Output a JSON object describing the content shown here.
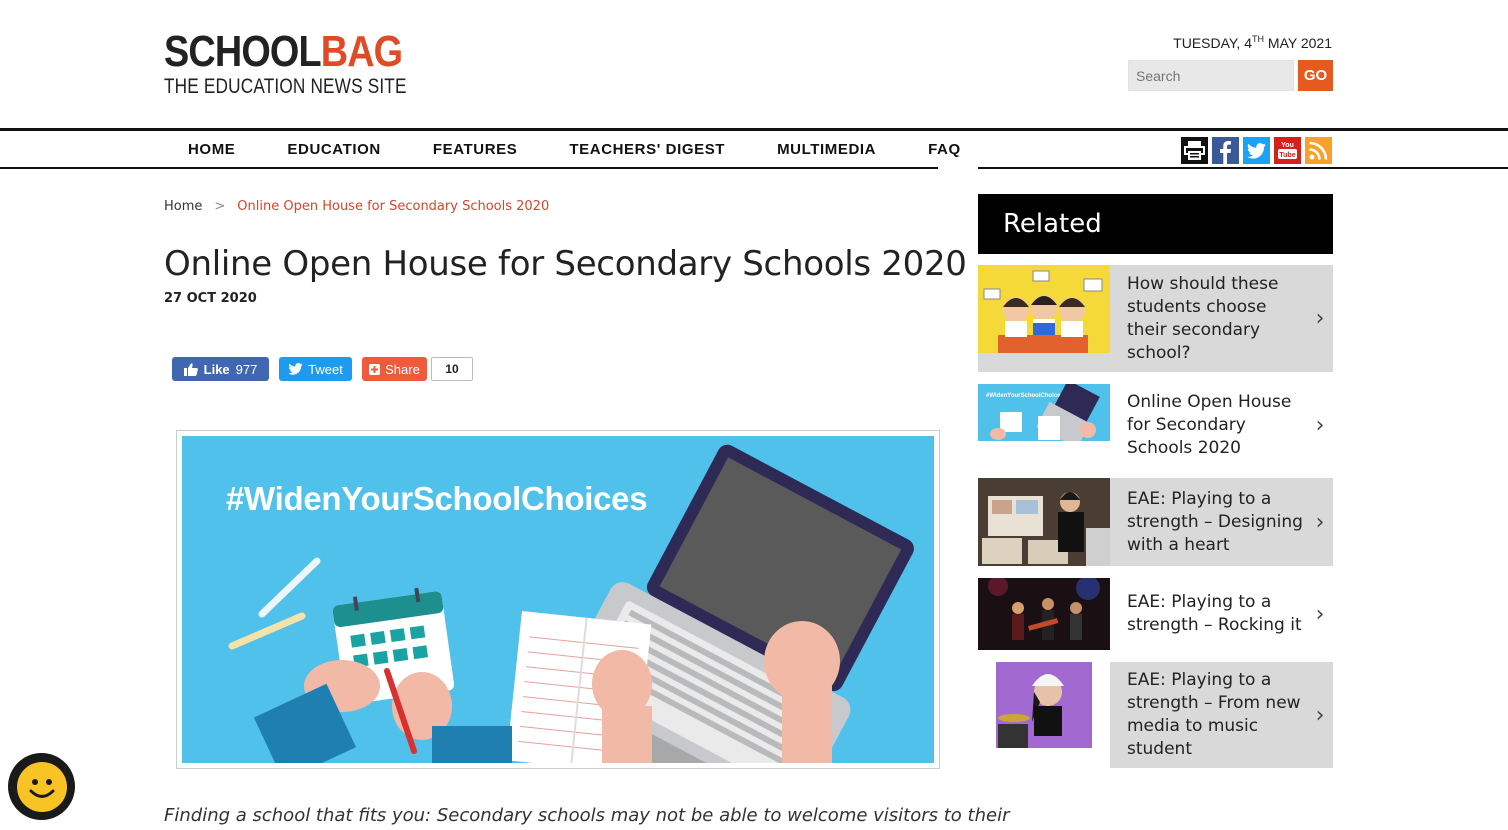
{
  "header": {
    "logo_school": "SCHOOL",
    "logo_bag": "BAG",
    "logo_tagline": "THE EDUCATION NEWS SITE",
    "date_prefix": "TUESDAY, 4",
    "date_sup": "TH",
    "date_suffix": " MAY 2021",
    "search_placeholder": "Search",
    "go_label": "GO"
  },
  "nav": {
    "items": [
      "HOME",
      "EDUCATION",
      "FEATURES",
      "TEACHERS' DIGEST",
      "MULTIMEDIA",
      "FAQ"
    ]
  },
  "social_icons": [
    "print-icon",
    "facebook-icon",
    "twitter-icon",
    "youtube-icon",
    "rss-icon"
  ],
  "breadcrumb": {
    "home": "Home",
    "separator": ">",
    "current": "Online Open House for Secondary Schools 2020"
  },
  "article": {
    "title": "Online Open House for Secondary Schools 2020",
    "date": "27 OCT 2020",
    "hero_text": "#WidenYourSchoolChoices",
    "lead": "Finding a school that fits you: Secondary schools may not be able to welcome visitors to their"
  },
  "share": {
    "like_label": "Like",
    "like_count": "977",
    "tweet_label": "Tweet",
    "share_label": "Share",
    "share_count": "10"
  },
  "related": {
    "heading": "Related",
    "items": [
      {
        "title": "How should these students choose their secondary school?"
      },
      {
        "title": "Online Open House for Secondary Schools 2020"
      },
      {
        "title": "EAE: Playing to a strength – Designing with a heart"
      },
      {
        "title": "EAE: Playing to a strength – Rocking it"
      },
      {
        "title": "EAE: Playing to a strength – From new media to music student"
      }
    ]
  },
  "colors": {
    "brand_orange": "#e04a25",
    "go_button": "#e55a1f",
    "breadcrumb_current": "#d9442a",
    "hero_bg": "#4fc1ea"
  }
}
